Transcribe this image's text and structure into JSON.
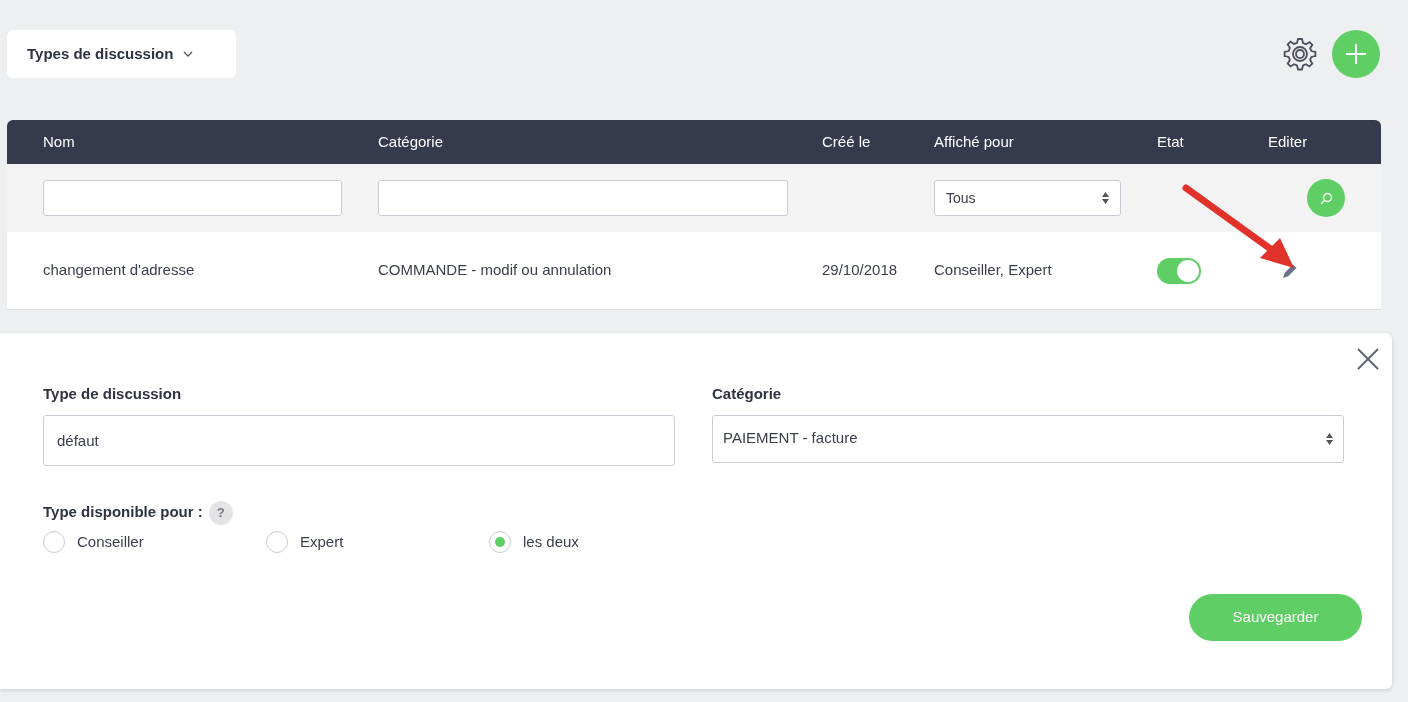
{
  "toolbar": {
    "dropdown_label": "Types de discussion"
  },
  "table": {
    "columns": [
      "Nom",
      "Catégorie",
      "Créé le",
      "Affiché pour",
      "Etat",
      "Editer"
    ],
    "filters": [
      {
        "kind": "text"
      },
      {
        "kind": "text"
      },
      {
        "kind": "none"
      },
      {
        "kind": "select",
        "value": "Tous"
      },
      {
        "kind": "none"
      },
      {
        "kind": "search"
      }
    ],
    "rows": [
      {
        "nom": "changement d'adresse",
        "categorie": "COMMANDE - modif ou annulation",
        "cree_le": "29/10/2018",
        "affiche_pour": "Conseiller, Expert",
        "on": true
      }
    ]
  },
  "form": {
    "name_label": "Type de discussion",
    "name_value": "défaut",
    "category_label": "Catégorie",
    "category_value": "PAIEMENT - facture",
    "availability_label": "Type disponible pour :",
    "help": "?",
    "options": [
      {
        "label": "Conseiller",
        "selected": false
      },
      {
        "label": "Expert",
        "selected": false
      },
      {
        "label": "les deux",
        "selected": true
      }
    ],
    "save": "Sauvegarder"
  }
}
